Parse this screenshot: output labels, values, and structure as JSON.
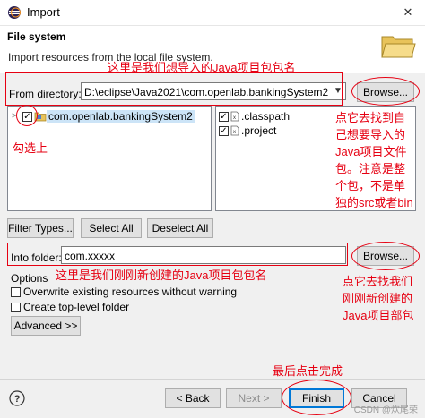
{
  "window": {
    "title": "Import",
    "minimize": "—",
    "close": "✕"
  },
  "header": {
    "title": "File system",
    "description": "Import resources from the local file system."
  },
  "directory": {
    "label": "From directory:",
    "value": "D:\\eclipse\\Java2021\\com.openlab.bankingSystem2",
    "browse": "Browse..."
  },
  "tree": {
    "items": [
      {
        "label": "com.openlab.bankingSystem2",
        "checked": true
      }
    ]
  },
  "files": {
    "items": [
      {
        "label": ".classpath",
        "checked": true
      },
      {
        "label": ".project",
        "checked": true
      }
    ]
  },
  "buttons": {
    "filter": "Filter Types...",
    "select_all": "Select All",
    "deselect_all": "Deselect All"
  },
  "into_folder": {
    "label": "Into folder:",
    "value": "com.xxxxx",
    "browse": "Browse..."
  },
  "options": {
    "label": "Options",
    "overwrite": "Overwrite existing resources without warning",
    "toplevel": "Create top-level folder",
    "advanced": "Advanced >>"
  },
  "footer": {
    "back": "< Back",
    "next": "Next >",
    "finish": "Finish",
    "cancel": "Cancel",
    "help": "?"
  },
  "annotations": {
    "project_name_note": "这里是我们想导入的Java项目包包名",
    "check_note": "勾选上",
    "browse_note_lines": [
      "点它去找到自",
      "己想要导入的",
      "Java项目文件",
      "包。注意是整",
      "个包，不是单",
      "独的src或者bin"
    ],
    "into_note": "这里是我们刚刚新创建的Java项目包包名",
    "browse2_note_lines": [
      "点它去找我们",
      "刚刚新创建的",
      "Java项目部包"
    ],
    "finish_note": "最后点击完成"
  },
  "watermark": "CSDN @炊尾荣",
  "colors": {
    "annotation": "#e60012",
    "focus": "#0078d7"
  }
}
